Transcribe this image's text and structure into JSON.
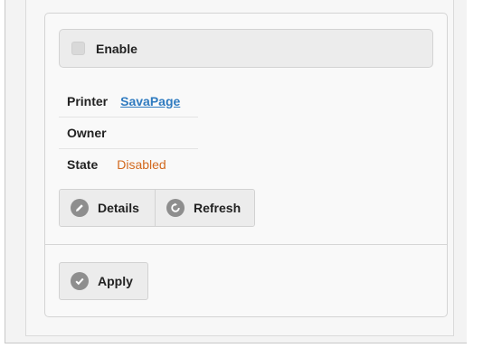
{
  "enable": {
    "label": "Enable",
    "checked": false
  },
  "info": {
    "printer_label": "Printer",
    "printer_value": "SavaPage",
    "owner_label": "Owner",
    "owner_value": "",
    "state_label": "State",
    "state_value": "Disabled"
  },
  "buttons": {
    "details": "Details",
    "refresh": "Refresh",
    "apply": "Apply"
  },
  "icons": {
    "details": "pencil-icon",
    "refresh": "refresh-icon",
    "apply": "check-icon"
  },
  "colors": {
    "link": "#2f7bc0",
    "state_disabled": "#d2691e",
    "icon_bg": "#8e8e8e"
  }
}
